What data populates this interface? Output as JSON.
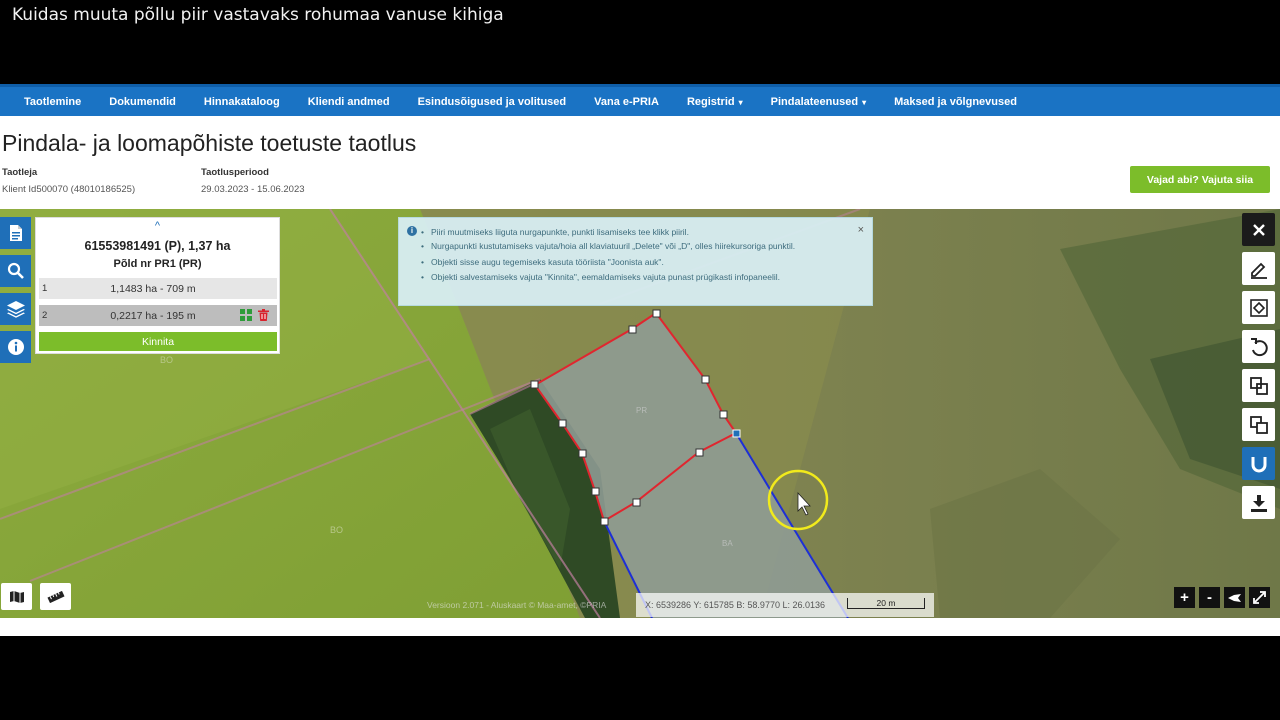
{
  "video_title": "Kuidas muuta põllu piir vastavaks rohumaa vanuse kihiga",
  "nav": {
    "items": [
      {
        "label": "Taotlemine",
        "dropdown": false
      },
      {
        "label": "Dokumendid",
        "dropdown": false
      },
      {
        "label": "Hinnakataloog",
        "dropdown": false
      },
      {
        "label": "Kliendi andmed",
        "dropdown": false
      },
      {
        "label": "Esindusõigused ja volitused",
        "dropdown": false
      },
      {
        "label": "Vana e-PRIA",
        "dropdown": false
      },
      {
        "label": "Registrid",
        "dropdown": true
      },
      {
        "label": "Pindalateenused",
        "dropdown": true
      },
      {
        "label": "Maksed ja võlgnevused",
        "dropdown": false
      }
    ],
    "caret": "▾"
  },
  "page": {
    "title": "Pindala- ja loomapõhiste toetuste taotlus",
    "applicant_label": "Taotleja",
    "applicant_value": "Klient Id500070 (48010186525)",
    "period_label": "Taotlusperiood",
    "period_value": "29.03.2023 - 15.06.2023",
    "help_button": "Vajad abi? Vajuta siia"
  },
  "panel": {
    "collapse_glyph": "^",
    "title": "61553981491 (P), 1,37 ha",
    "subtitle": "Põld nr PR1 (PR)",
    "rows": [
      {
        "num": "1",
        "value": "1,1483 ha - 709 m"
      },
      {
        "num": "2",
        "value": "0,2217 ha - 195 m"
      }
    ],
    "confirm_button": "Kinnita"
  },
  "info": {
    "close_glyph": "×",
    "items": [
      "Piiri muutmiseks liiguta nurgapunkte, punkti lisamiseks tee klikk piiril.",
      "Nurgapunkti kustutamiseks vajuta/hoia all klaviatuuril „Delete\" või „D\", olles hiirekursoriga punktil.",
      "Objekti sisse augu tegemiseks kasuta tööriista \"Joonista auk\".",
      "Objekti salvestamiseks vajuta \"Kinnita\", eemaldamiseks vajuta punast prügikasti infopaneelil."
    ]
  },
  "map": {
    "labels": {
      "bo_left_top": "BO",
      "bo_left": "BO",
      "pr": "PR",
      "ba": "BA"
    },
    "coords": "X: 6539286 Y: 615785 B: 58.9770 L: 26.0136",
    "scale": "20 m",
    "version": "Versioon 2.071 - Aluskaart © Maa-amet, ©PRIA",
    "zoom_in": "+",
    "zoom_out": "-"
  },
  "colors": {
    "nav_blue": "#1a73c4",
    "accent_green": "#7cbd2a",
    "boundary_red": "#e0262f",
    "boundary_blue": "#1d2fd6",
    "cursor_highlight": "#f1ea1c"
  },
  "icons": {
    "left_tools": [
      "document-icon",
      "search-icon",
      "layers-icon",
      "info-icon"
    ],
    "right_tools": [
      "close-icon",
      "edit-icon",
      "select-icon",
      "undo-icon",
      "merge-icon",
      "split-icon",
      "magnet-icon",
      "download-icon"
    ]
  }
}
